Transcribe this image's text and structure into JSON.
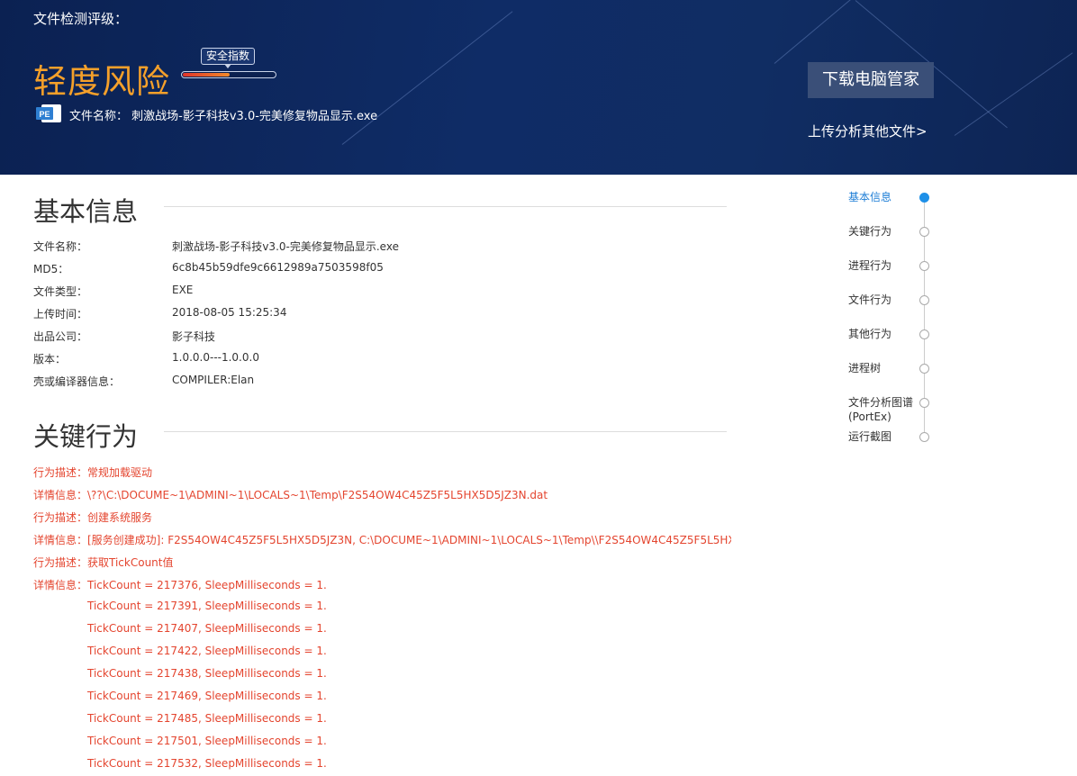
{
  "header": {
    "label": "文件检测评级：",
    "risk_level": "轻度风险",
    "score_label": "安全指数",
    "score_fraction": 0.5,
    "file_name_label": "文件名称：",
    "file_name": "刺激战场-影子科技v3.0-完美修复物品显示.exe",
    "pe_icon_text": "PE",
    "download_button": "下载电脑管家",
    "upload_link": "上传分析其他文件>"
  },
  "basic_info": {
    "title": "基本信息",
    "rows": [
      {
        "label": "文件名称：",
        "value": "刺激战场-影子科技v3.0-完美修复物品显示.exe"
      },
      {
        "label": "MD5：",
        "value": "6c8b45b59dfe9c6612989a7503598f05"
      },
      {
        "label": "文件类型：",
        "value": "EXE"
      },
      {
        "label": "上传时间：",
        "value": "2018-08-05 15:25:34"
      },
      {
        "label": "出品公司：",
        "value": "影子科技"
      },
      {
        "label": "版本：",
        "value": "1.0.0.0---1.0.0.0"
      },
      {
        "label": "壳或编译器信息：",
        "value": "COMPILER:Elan"
      }
    ]
  },
  "key_behavior": {
    "title": "关键行为",
    "lines": [
      "行为描述：常规加载驱动",
      "详情信息：\\??\\C:\\DOCUME~1\\ADMINI~1\\LOCALS~1\\Temp\\F2S54OW4C45Z5F5L5HX5D5JZ3N.dat",
      "行为描述：创建系统服务",
      "详情信息：[服务创建成功]: F2S54OW4C45Z5F5L5HX5D5JZ3N, C:\\DOCUME~1\\ADMINI~1\\LOCALS~1\\Temp\\\\F2S54OW4C45Z5F5L5HX...",
      "行为描述：获取TickCount值",
      "详情信息：TickCount = 217376, SleepMilliseconds = 1."
    ],
    "continuation": [
      "TickCount = 217391, SleepMilliseconds = 1.",
      "TickCount = 217407, SleepMilliseconds = 1.",
      "TickCount = 217422, SleepMilliseconds = 1.",
      "TickCount = 217438, SleepMilliseconds = 1.",
      "TickCount = 217469, SleepMilliseconds = 1.",
      "TickCount = 217485, SleepMilliseconds = 1.",
      "TickCount = 217501, SleepMilliseconds = 1.",
      "TickCount = 217532, SleepMilliseconds = 1."
    ]
  },
  "nav": {
    "items": [
      {
        "label": "基本信息",
        "active": true
      },
      {
        "label": "关键行为",
        "active": false
      },
      {
        "label": "进程行为",
        "active": false
      },
      {
        "label": "文件行为",
        "active": false
      },
      {
        "label": "其他行为",
        "active": false
      },
      {
        "label": "进程树",
        "active": false
      },
      {
        "label": "文件分析图谱",
        "label2": "(PortEx)",
        "active": false
      },
      {
        "label": "运行截图",
        "active": false
      }
    ]
  },
  "colors": {
    "header_bg": "#0f2c66",
    "risk": "#f5a02a",
    "behavior_text": "#e4452f",
    "nav_active": "#1e7ed6"
  }
}
